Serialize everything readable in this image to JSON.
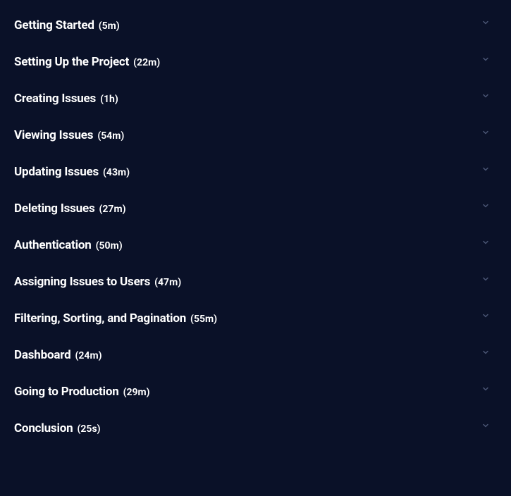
{
  "sections": [
    {
      "title": "Getting Started",
      "duration": "(5m)"
    },
    {
      "title": "Setting Up the Project",
      "duration": "(22m)"
    },
    {
      "title": "Creating Issues",
      "duration": "(1h)"
    },
    {
      "title": "Viewing Issues",
      "duration": "(54m)"
    },
    {
      "title": "Updating Issues",
      "duration": "(43m)"
    },
    {
      "title": "Deleting Issues",
      "duration": "(27m)"
    },
    {
      "title": "Authentication",
      "duration": "(50m)"
    },
    {
      "title": "Assigning Issues to Users",
      "duration": "(47m)"
    },
    {
      "title": "Filtering, Sorting, and Pagination",
      "duration": "(55m)"
    },
    {
      "title": "Dashboard",
      "duration": "(24m)"
    },
    {
      "title": "Going to Production",
      "duration": "(29m)"
    },
    {
      "title": "Conclusion",
      "duration": "(25s)"
    }
  ]
}
